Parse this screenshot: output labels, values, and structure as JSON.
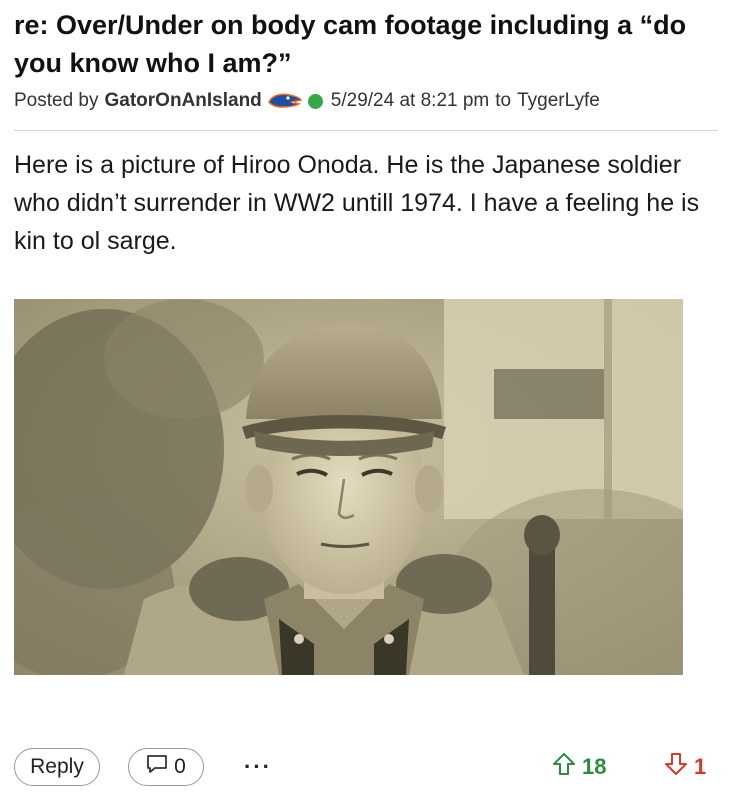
{
  "post": {
    "title": "re: Over/Under on body cam footage including a “do you know who I am?”",
    "posted_by_label": "Posted by",
    "author": "GatorOnAnIsland",
    "team_icon": "florida-gator-logo",
    "online_status": "online",
    "timestamp": "5/29/24 at 8:21 pm",
    "to_label": "to",
    "recipient": "TygerLyfe",
    "body": "Here is a picture of Hiroo Onoda. He is the Japanese soldier who didn’t surrender in WW2 untill 1974. I have a feeling he is kin to ol sarge.",
    "image_description_icon": "sepia-photo"
  },
  "footer": {
    "reply_label": "Reply",
    "comment_icon": "speech-bubble-icon",
    "comment_count": "0",
    "more_label": "···",
    "upvotes": "18",
    "downvotes": "1"
  },
  "colors": {
    "online": "#35a84a",
    "upvote": "#2e8b3e",
    "downvote": "#d23a2c",
    "gator_blue": "#1f4fa3",
    "gator_orange": "#f06a1d"
  }
}
